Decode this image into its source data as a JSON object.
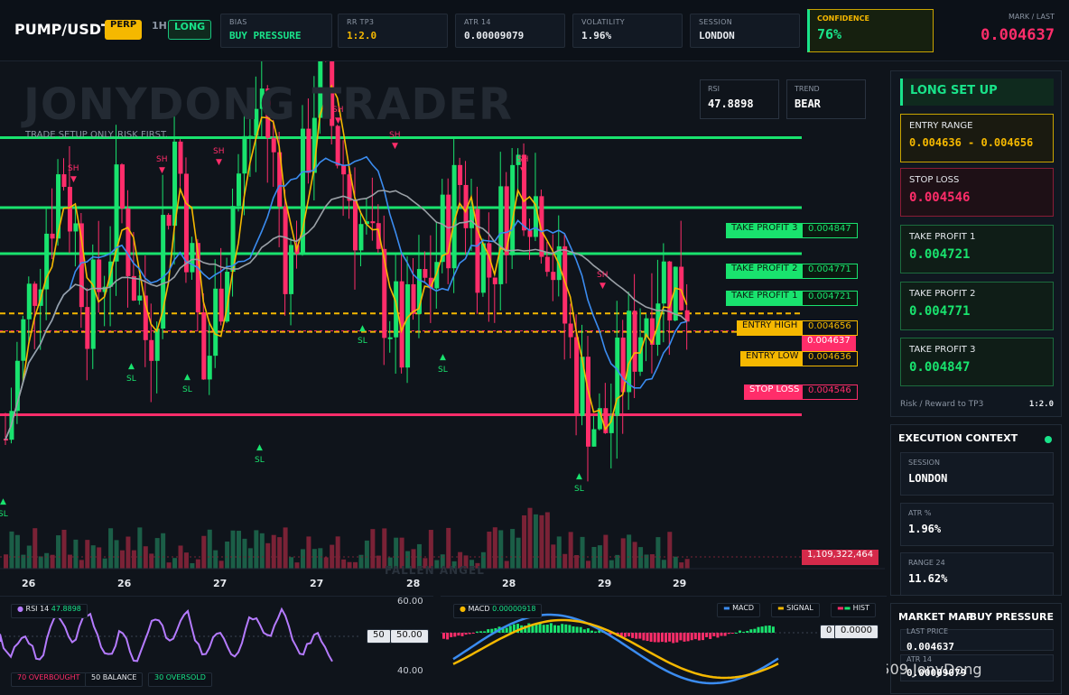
{
  "top": {
    "pair": "PUMP/USDT",
    "perp": "PERP",
    "timeframe": "1H",
    "side": "LONG",
    "stats": [
      {
        "label": "BIAS",
        "value": "BUY PRESSURE",
        "color": "#19e38a"
      },
      {
        "label": "RR TP3",
        "value": "1:2.0",
        "color": "#f5b800"
      },
      {
        "label": "ATR 14",
        "value": "0.00009079",
        "color": "#e6e9ee"
      },
      {
        "label": "VOLATILITY",
        "value": "1.96%",
        "color": "#e6e9ee"
      },
      {
        "label": "SESSION",
        "value": "LONDON",
        "color": "#e6e9ee"
      }
    ],
    "confidence": {
      "label": "CONFIDENCE",
      "value": "76%"
    },
    "mark": {
      "label": "MARK / LAST",
      "value": "0.004637"
    }
  },
  "chart": {
    "watermark": "JONYDONG TRADER",
    "subtitle": "TRADE SETUP ONLY. RISK FIRST.",
    "rsi_box": {
      "label": "RSI",
      "value": "47.8898"
    },
    "trend_box": {
      "label": "TREND",
      "value": "BEAR"
    },
    "levels": {
      "tp3": {
        "label": "TAKE PROFIT 3",
        "value": "0.004847"
      },
      "tp2": {
        "label": "TAKE PROFIT 2",
        "value": "0.004771"
      },
      "tp1": {
        "label": "TAKE PROFIT 1",
        "value": "0.004721"
      },
      "entry_high": {
        "label": "ENTRY HIGH",
        "value": "0.004656"
      },
      "last": {
        "value": "0.004637"
      },
      "entry_low": {
        "label": "ENTRY LOW",
        "value": "0.004636"
      },
      "stop": {
        "label": "STOP LOSS",
        "value": "0.004546"
      }
    },
    "volume_label": "1,109,322,464",
    "x_labels": [
      "26",
      "26",
      "27",
      "27",
      "28",
      "28",
      "29",
      "29"
    ],
    "bottom_watermark": "FALLEN ANGEL",
    "sh": "SH",
    "sl": "SL"
  },
  "panel": {
    "title": "LONG SET UP",
    "entry": {
      "label": "ENTRY RANGE",
      "value": "0.004636 - 0.004656"
    },
    "stop": {
      "label": "STOP LOSS",
      "value": "0.004546"
    },
    "tp1": {
      "label": "TAKE PROFIT 1",
      "value": "0.004721"
    },
    "tp2": {
      "label": "TAKE PROFIT 2",
      "value": "0.004771"
    },
    "tp3": {
      "label": "TAKE PROFIT 3",
      "value": "0.004847"
    },
    "rr": {
      "label": "Risk / Reward to TP3",
      "value": "1:2.0"
    }
  },
  "exec": {
    "title": "EXECUTION CONTEXT",
    "session": {
      "label": "SESSION",
      "value": "LONDON"
    },
    "atr": {
      "label": "ATR %",
      "value": "1.96%"
    },
    "range": {
      "label": "RANGE 24",
      "value": "11.62%"
    }
  },
  "market_map": {
    "title": "MARKET MAP",
    "pressure": "BUY PRESSURE",
    "last_label": "LAST PRICE",
    "last_value": "0.004637",
    "atr_label": "ATR 14",
    "atr_value": "0.00009079"
  },
  "rsi_panel": {
    "title": "RSI 14",
    "value": "47.8898",
    "axis_top": "60.00",
    "axis_bottom": "40.00",
    "mid_tag": "50",
    "mid_value": "50.00",
    "legend": [
      "70 OVERBOUGHT",
      "50 BALANCE",
      "30 OVERSOLD"
    ]
  },
  "macd_panel": {
    "title": "MACD",
    "value": "0.00000918",
    "legend": [
      "MACD",
      "SIGNAL",
      "HIST"
    ],
    "zero_tag": "0",
    "zero_value": "0.0000"
  },
  "credit": "509 JonyDong",
  "colors": {
    "bull": "#19e36e",
    "bear": "#ff2d6a",
    "gold": "#f5b800",
    "ma_blue": "#3b8cf0",
    "ma_gray": "#9aa0a6"
  }
}
